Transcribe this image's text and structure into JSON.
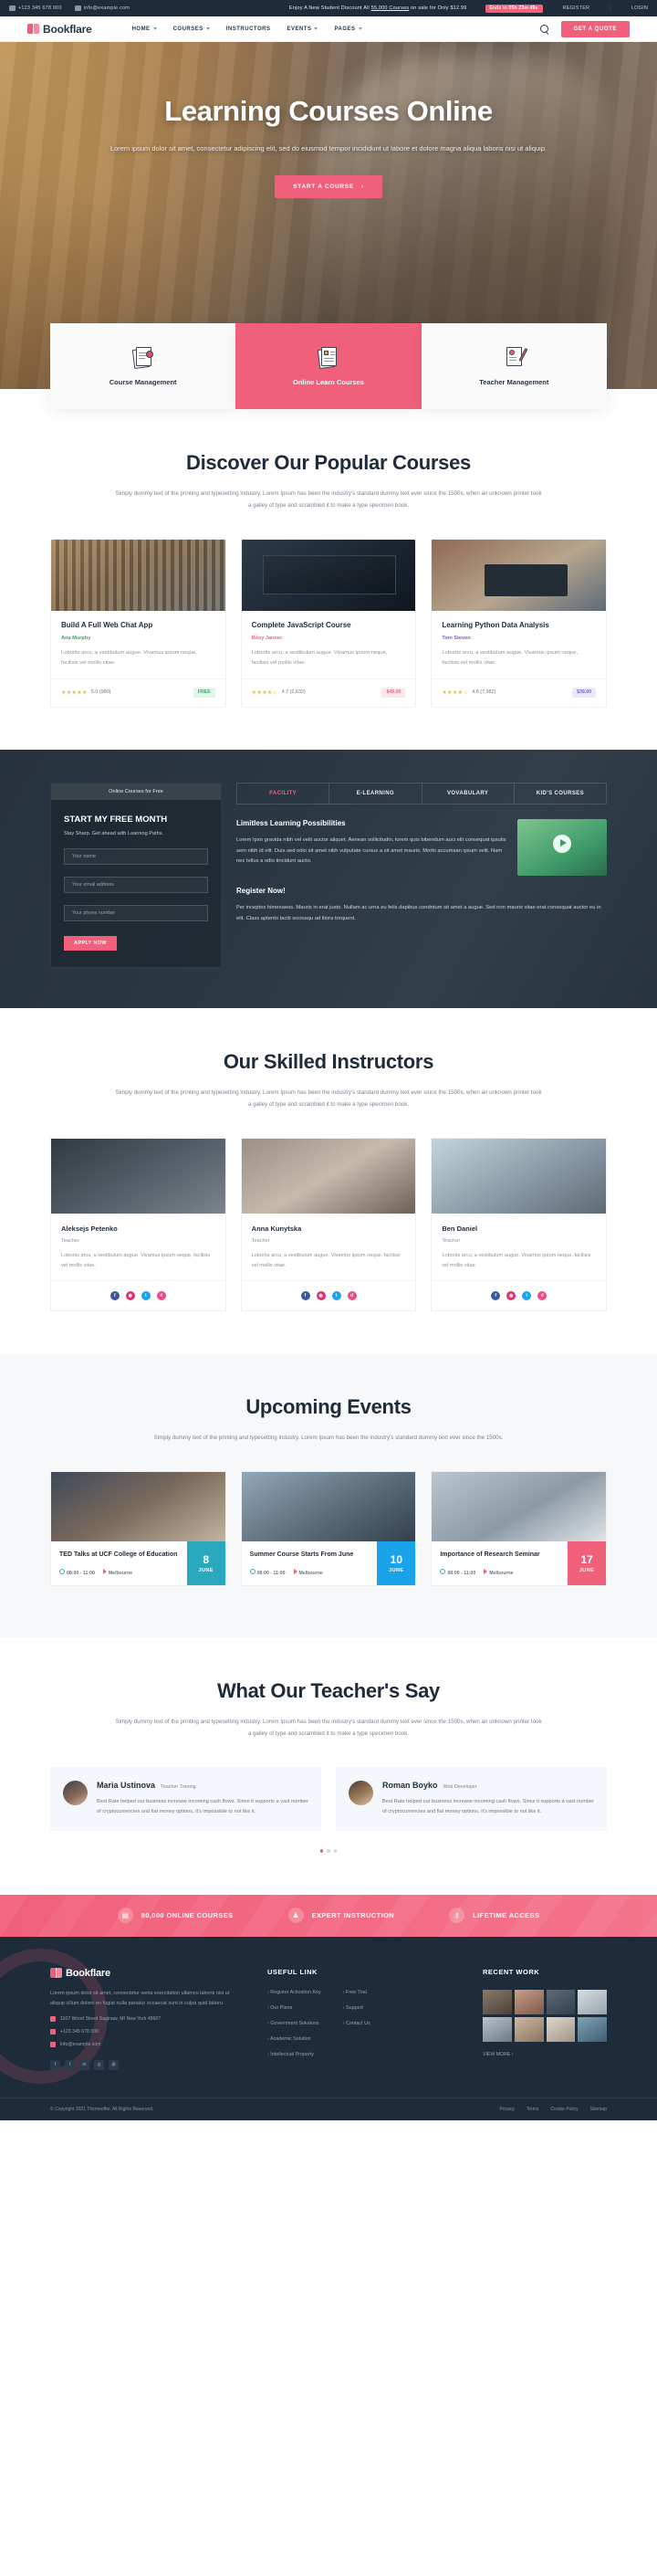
{
  "topbar": {
    "phone": "+123 345 678 000",
    "email": "info@example.com",
    "promo_prefix": "Enjoy A New Student Discount All",
    "promo_link": "55,000 Courses",
    "promo_suffix": "on sale for Only $12.99",
    "countdown": "Ends in 05h 23m 49s",
    "register": "REGISTER",
    "separator": "|",
    "login": "LOGIN"
  },
  "nav": {
    "brand": "Bookflare",
    "items": [
      {
        "label": "HOME",
        "caret": true
      },
      {
        "label": "COURSES",
        "caret": true
      },
      {
        "label": "INSTRUCTORS",
        "caret": false
      },
      {
        "label": "EVENTS",
        "caret": true
      },
      {
        "label": "PAGES",
        "caret": true
      }
    ],
    "search_icon": "search-icon",
    "quote_button": "GET A QUOTE"
  },
  "hero": {
    "title": "Learning Courses Online",
    "subtitle": "Lorem ipsum dolor sit amet, consectetur adipiscing elit, sed do eiusmod tempor incididunt ut labore et dolore magna aliqua laboris nisi ut aliquip.",
    "cta": "START A COURSE",
    "cta_arrow": "›"
  },
  "features": [
    {
      "label": "Course Management",
      "active": false,
      "icon": "certificate-doc-icon"
    },
    {
      "label": "Online Learn Courses",
      "active": true,
      "icon": "checklist-doc-icon"
    },
    {
      "label": "Teacher Management",
      "active": false,
      "icon": "pencil-doc-icon"
    }
  ],
  "courses_section": {
    "title": "Discover Our Popular Courses",
    "subtitle": "Simply dummy text of the printing and typesetting industry. Lorem Ipsum has been the industry's standard dummy text ever since the 1500s, when an unknown printer took a galley of type and scrambled it to make a type specimen book.",
    "items": [
      {
        "title": "Build A Full Web Chat App",
        "author": "Ana Murphy",
        "author_color": "#3da35d",
        "desc": "Lobortis arcu, a vestibulum augue. Vivamus ipsum neque, facilisis vel mollis vitae.",
        "stars": "★★★★★",
        "rating": "5.0 (980)",
        "price": "FREE",
        "price_class": "free"
      },
      {
        "title": "Complete JavaScript Course",
        "author": "Rosy Janner",
        "author_color": "#f1607a",
        "desc": "Lobortis arcu, a vestibulum augue. Vivamus ipsum neque, facilisis vel mollis vitae.",
        "stars": "★★★★☆",
        "rating": "4.7 (2,632)",
        "price": "$49.00",
        "price_class": "red"
      },
      {
        "title": "Learning Python Data Analysis",
        "author": "Tom Steven",
        "author_color": "#8a4fd6",
        "desc": "Lobortis arcu, a vestibulum augue. Vivamus ipsum neque, facilisis vel mollis vitae.",
        "stars": "★★★★☆",
        "rating": "4.8 (7,982)",
        "price": "$39.00",
        "price_class": "purple"
      }
    ]
  },
  "promo": {
    "left_head": "Online Courses for Free",
    "left_title": "START MY FREE MONTH",
    "left_sub": "Stay Sharp. Get ahead with Learning Paths.",
    "fields": [
      {
        "placeholder": "Your name"
      },
      {
        "placeholder": "Your email address"
      },
      {
        "placeholder": "Your phone number"
      }
    ],
    "apply": "APPLY NOW",
    "tabs": [
      {
        "label": "FACILITY",
        "active": true
      },
      {
        "label": "E-LEARNING",
        "active": false
      },
      {
        "label": "VOVABULARY",
        "active": false
      },
      {
        "label": "KID'S COURSES",
        "active": false
      }
    ],
    "heading1": "Limitless Learning Possibilities",
    "body1": "Lorem Ipsn gravida nibh vel velit auctor aliquet. Aenean sollicitudin, lorem quis bibendum auci elit consequat ipsutis sem nibh id elit. Duis sed odio sit amet nibh vulputate cursus a sit amet mauris. Morbi accumsan ipsum velit. Nam nec tellus a odio tincidunt aucto.",
    "heading2": "Register Now!",
    "body2": "Per inceptos himenaeos. Mauris in erat justo. Nullam ac urna eu felis dapibus condntum sit amet a augue. Sed non mauris vitae erat consequat auctor eu in elit. Class aptento taciti sociosqu ad litora torquent.",
    "video_icon": "play-button-icon"
  },
  "instructors_section": {
    "title": "Our Skilled Instructors",
    "subtitle": "Simply dummy text of the printing and typesetting industry. Lorem Ipsum has been the industry's standard dummy text ever since the 1500s, when an unknown printer took a galley of type and scrambled it to make a type specimen book.",
    "items": [
      {
        "name": "Aleksejs Petenko",
        "role": "Teacher",
        "desc": "Lobortis arcu, a vestibulum augue. Vivamus ipsum neque, facilisis vel mollis vitae."
      },
      {
        "name": "Anna Kunytska",
        "role": "Teacher",
        "desc": "Lobortis arcu, a vestibulum augue. Vivamus ipsum neque, facilisis vel mollis vitae."
      },
      {
        "name": "Ben Daniel",
        "role": "Teacher",
        "desc": "Lobortis arcu, a vestibulum augue. Vivamus ipsum neque, facilisis vel mollis vitae."
      }
    ],
    "socials": [
      "f",
      "◉",
      "t",
      "d"
    ]
  },
  "events_section": {
    "title": "Upcoming Events",
    "subtitle": "Simply dummy text of the printing and typesetting industry. Lorem Ipsum has been the industry's standard dummy text ever since the 1500s.",
    "items": [
      {
        "title": "TED Talks at UCF College of Education",
        "time": "08:00 - 11:00",
        "place": "Melbourne",
        "day": "8",
        "month": "JUNE",
        "color": "d-teal"
      },
      {
        "title": "Summer Course Starts From June",
        "time": "08:00 - 11:00",
        "place": "Melbourne",
        "day": "10",
        "month": "JUNE",
        "color": "d-blue"
      },
      {
        "title": "Importance of Research Seminar",
        "time": "08:00 - 11:00",
        "place": "Melbourne",
        "day": "17",
        "month": "JUNE",
        "color": "d-pink"
      }
    ]
  },
  "testimonials_section": {
    "title": "What Our Teacher's Say",
    "subtitle": "Simply dummy text of the printing and typesetting industry. Lorem Ipsum has been the industry's standard dummy text ever since the 1500s, when an unknown printer took a galley of type and scrambled it to make a type specimen book.",
    "items": [
      {
        "name": "Maria Ustinova",
        "role": "Teacher Traning",
        "text": "Best Rate helped our business increase incoming cash flows. Since it supports a vast number of cryptocurrencies and fiat money options, it's impossible to not like it."
      },
      {
        "name": "Roman Boyko",
        "role": "Web Developer",
        "text": "Best Rate helped our business increase incoming cash flows. Since it supports a vast number of cryptocurrencies and fiat money options, it's impossible to not like it."
      }
    ]
  },
  "strip": [
    {
      "label": "80,000 ONLINE COURSES",
      "icon": "book-icon",
      "glyph": "▤"
    },
    {
      "label": "EXPERT INSTRUCTION",
      "icon": "teacher-icon",
      "glyph": "♟"
    },
    {
      "label": "LIFETIME ACCESS",
      "icon": "key-icon",
      "glyph": "⚷"
    }
  ],
  "footer": {
    "brand": "Bookflare",
    "about": "Lorem ipsum dolor sit amet, consectetur venia exercitation ullamco laboris nisi ut aliquip cillum dolore eu fugiat nulla pariatur occaecat sunt in culpa quid laboru.",
    "address": "1107 Wood Street Saginaw, MI New York 48607",
    "phone": "+123 345 678 000",
    "email": "info@example.com",
    "socials": [
      "f",
      "t",
      "in",
      "g",
      "⊞"
    ],
    "useful_link_head": "USEFUL LINK",
    "links_col1": [
      "Register Activation Key",
      "Our Plans",
      "Government Solutions",
      "Academic Solution",
      "Intellectual Property"
    ],
    "links_col2": [
      "Free Trial",
      "Support",
      "Contact Us"
    ],
    "recent_work_head": "RECENT WORK",
    "view_more": "VIEW MORE ›",
    "copyright": "© Copyright 2021 Themeoffer. All Rights Reserved.",
    "bottom_links": [
      "Privacy",
      "Terms",
      "Cookie Policy",
      "Sitemap"
    ]
  }
}
